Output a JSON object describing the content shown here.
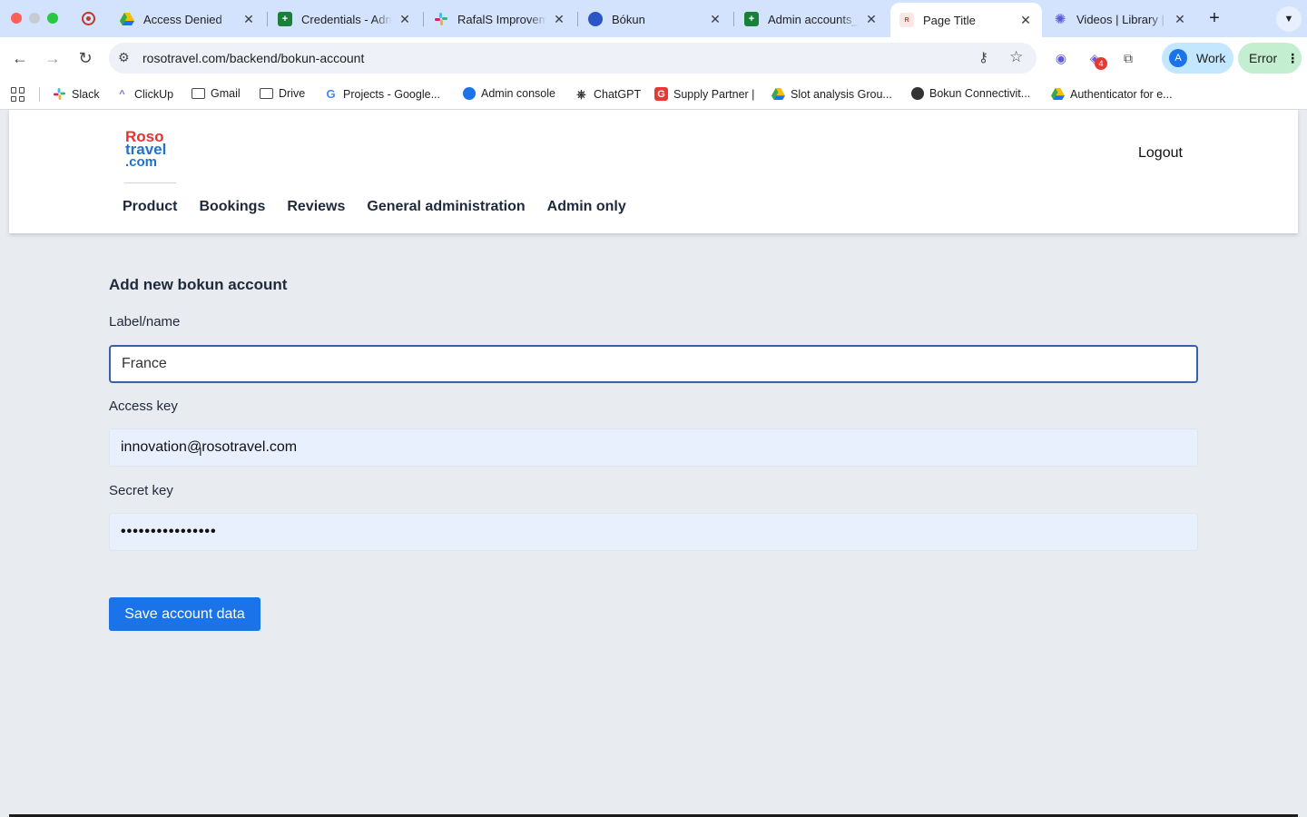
{
  "browser": {
    "tabs": [
      {
        "label": "Access Denied",
        "icon": "google-drive-icon"
      },
      {
        "label": "Credentials - Adm",
        "icon": "google-sheets-icon"
      },
      {
        "label": "RafalS Improveme",
        "icon": "slack-icon"
      },
      {
        "label": "Bókun",
        "icon": "bokun-icon"
      },
      {
        "label": "Admin accounts_",
        "icon": "google-sheets-icon"
      },
      {
        "label": "Page Title",
        "icon": "rosotravel-icon",
        "active": true
      },
      {
        "label": "Videos | Library |",
        "icon": "gear-flower-icon"
      }
    ],
    "url": "rosotravel.com/backend/bokun-account",
    "extension_badge": "4",
    "profile": {
      "initial": "A",
      "label": "Work"
    },
    "error_label": "Error",
    "bookmarks": [
      {
        "label": "Slack",
        "icon": "slack-icon"
      },
      {
        "label": "ClickUp",
        "icon": "clickup-icon"
      },
      {
        "label": "Gmail",
        "icon": "folder-icon"
      },
      {
        "label": "Drive",
        "icon": "folder-icon"
      },
      {
        "label": "Projects - Google...",
        "icon": "google-icon"
      },
      {
        "label": "Admin console",
        "icon": "admin-console-icon"
      },
      {
        "label": "ChatGPT",
        "icon": "chatgpt-icon"
      },
      {
        "label": "Supply Partner |",
        "icon": "getyourguide-icon"
      },
      {
        "label": "Slot analysis Grou...",
        "icon": "google-drive-icon"
      },
      {
        "label": "Bokun Connectivit...",
        "icon": "globe-icon"
      },
      {
        "label": "Authenticator for e...",
        "icon": "google-drive-icon"
      }
    ]
  },
  "site": {
    "logo": {
      "line1": "Roso",
      "line2": "travel",
      "line3": ".com"
    },
    "logout": "Logout",
    "nav": [
      "Product",
      "Bookings",
      "Reviews",
      "General administration",
      "Admin only"
    ]
  },
  "form": {
    "title": "Add new bokun account",
    "label_name": {
      "label": "Label/name",
      "value": "France"
    },
    "access_key": {
      "label": "Access key",
      "value": "innovation@rosotravel.com"
    },
    "secret_key": {
      "label": "Secret key",
      "value": "••••••••••••••••"
    },
    "save_label": "Save account data"
  },
  "colors": {
    "accent": "#1a73e8",
    "logo_red": "#e3342f",
    "logo_blue": "#1f73c9",
    "page_bg": "#e8ebf0",
    "input_bg": "#e8f0fe"
  }
}
